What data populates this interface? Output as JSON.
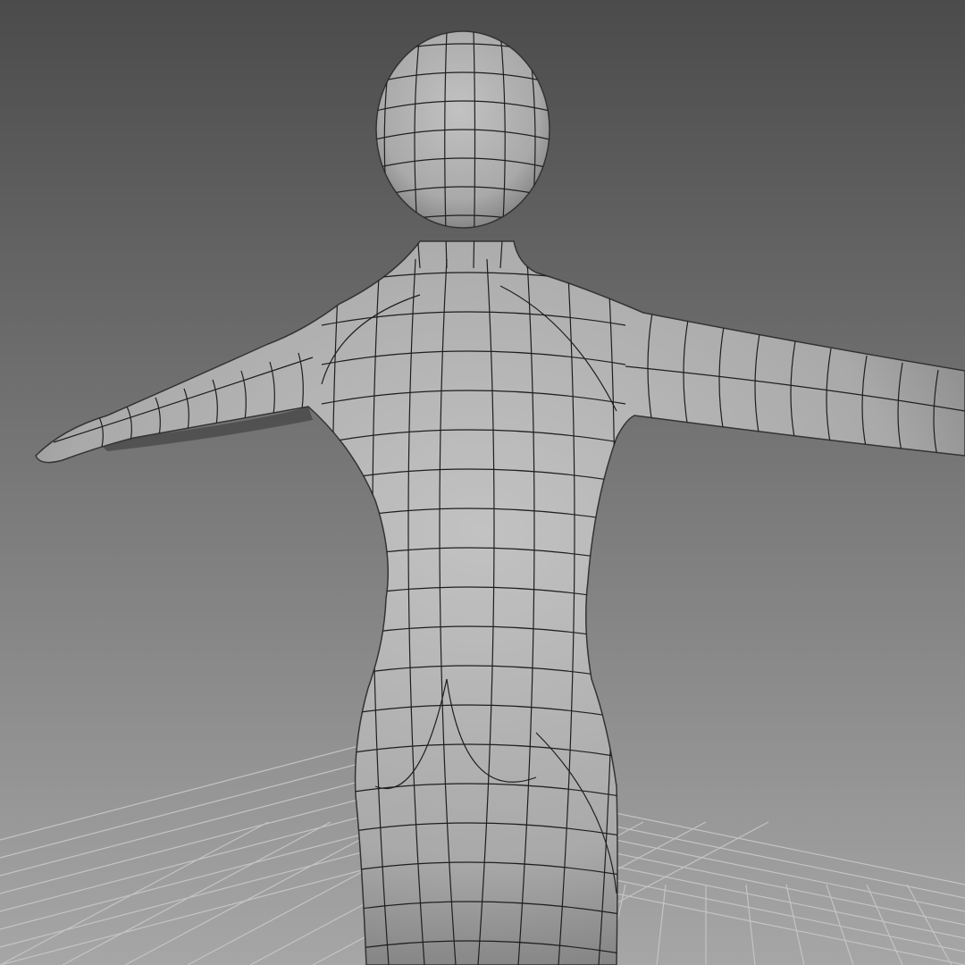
{
  "viewport": {
    "background_top": "#4b4b4b",
    "background_bottom": "#a6a6a6",
    "grid_color": "#c4c4c4",
    "mesh_light": "#c2c2c2",
    "mesh_dark": "#7c7c7c",
    "wire_color": "#1e1e1e"
  }
}
